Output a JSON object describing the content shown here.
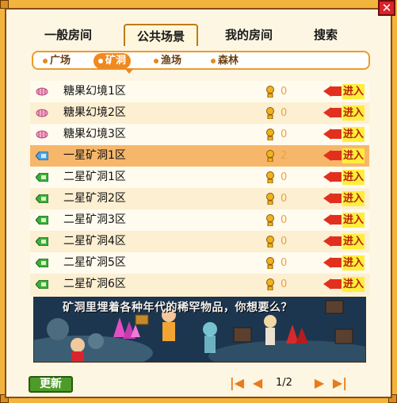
{
  "window": {
    "close_label": "✕"
  },
  "tabs": [
    {
      "label": "一般房间"
    },
    {
      "label": "公共场景",
      "active": true
    },
    {
      "label": "我的房间"
    },
    {
      "label": "搜索"
    }
  ],
  "subtabs": [
    {
      "label": "广场"
    },
    {
      "label": "矿洞",
      "active": true
    },
    {
      "label": "渔场"
    },
    {
      "label": "森林"
    }
  ],
  "rooms": [
    {
      "name": "糖果幻境1区",
      "count": "0",
      "enter": "进入",
      "icon": "candy-icon"
    },
    {
      "name": "糖果幻境2区",
      "count": "0",
      "enter": "进入",
      "icon": "candy-icon"
    },
    {
      "name": "糖果幻境3区",
      "count": "0",
      "enter": "进入",
      "icon": "candy-icon"
    },
    {
      "name": "一星矿洞1区",
      "count": "2",
      "enter": "进入",
      "icon": "blue-ticket-icon",
      "highlight": true
    },
    {
      "name": "二星矿洞1区",
      "count": "0",
      "enter": "进入",
      "icon": "green-ticket-icon"
    },
    {
      "name": "二星矿洞2区",
      "count": "0",
      "enter": "进入",
      "icon": "green-ticket-icon"
    },
    {
      "name": "二星矿洞3区",
      "count": "0",
      "enter": "进入",
      "icon": "green-ticket-icon"
    },
    {
      "name": "二星矿洞4区",
      "count": "0",
      "enter": "进入",
      "icon": "green-ticket-icon"
    },
    {
      "name": "二星矿洞5区",
      "count": "0",
      "enter": "进入",
      "icon": "green-ticket-icon"
    },
    {
      "name": "二星矿洞6区",
      "count": "0",
      "enter": "进入",
      "icon": "green-ticket-icon"
    }
  ],
  "banner": {
    "text": "矿洞里埋着各种年代的稀罕物品，你想要么？"
  },
  "footer": {
    "update_label": "更新",
    "page": "1/2",
    "first": "|◀",
    "prev": "◀",
    "next": "▶",
    "last": "▶|"
  },
  "colors": {
    "accent": "#ee8a1f",
    "frame": "#f3b43d",
    "highlight_row": "#f7b76a",
    "enter_yellow": "#ffee3b",
    "enter_red": "#e2301e"
  }
}
